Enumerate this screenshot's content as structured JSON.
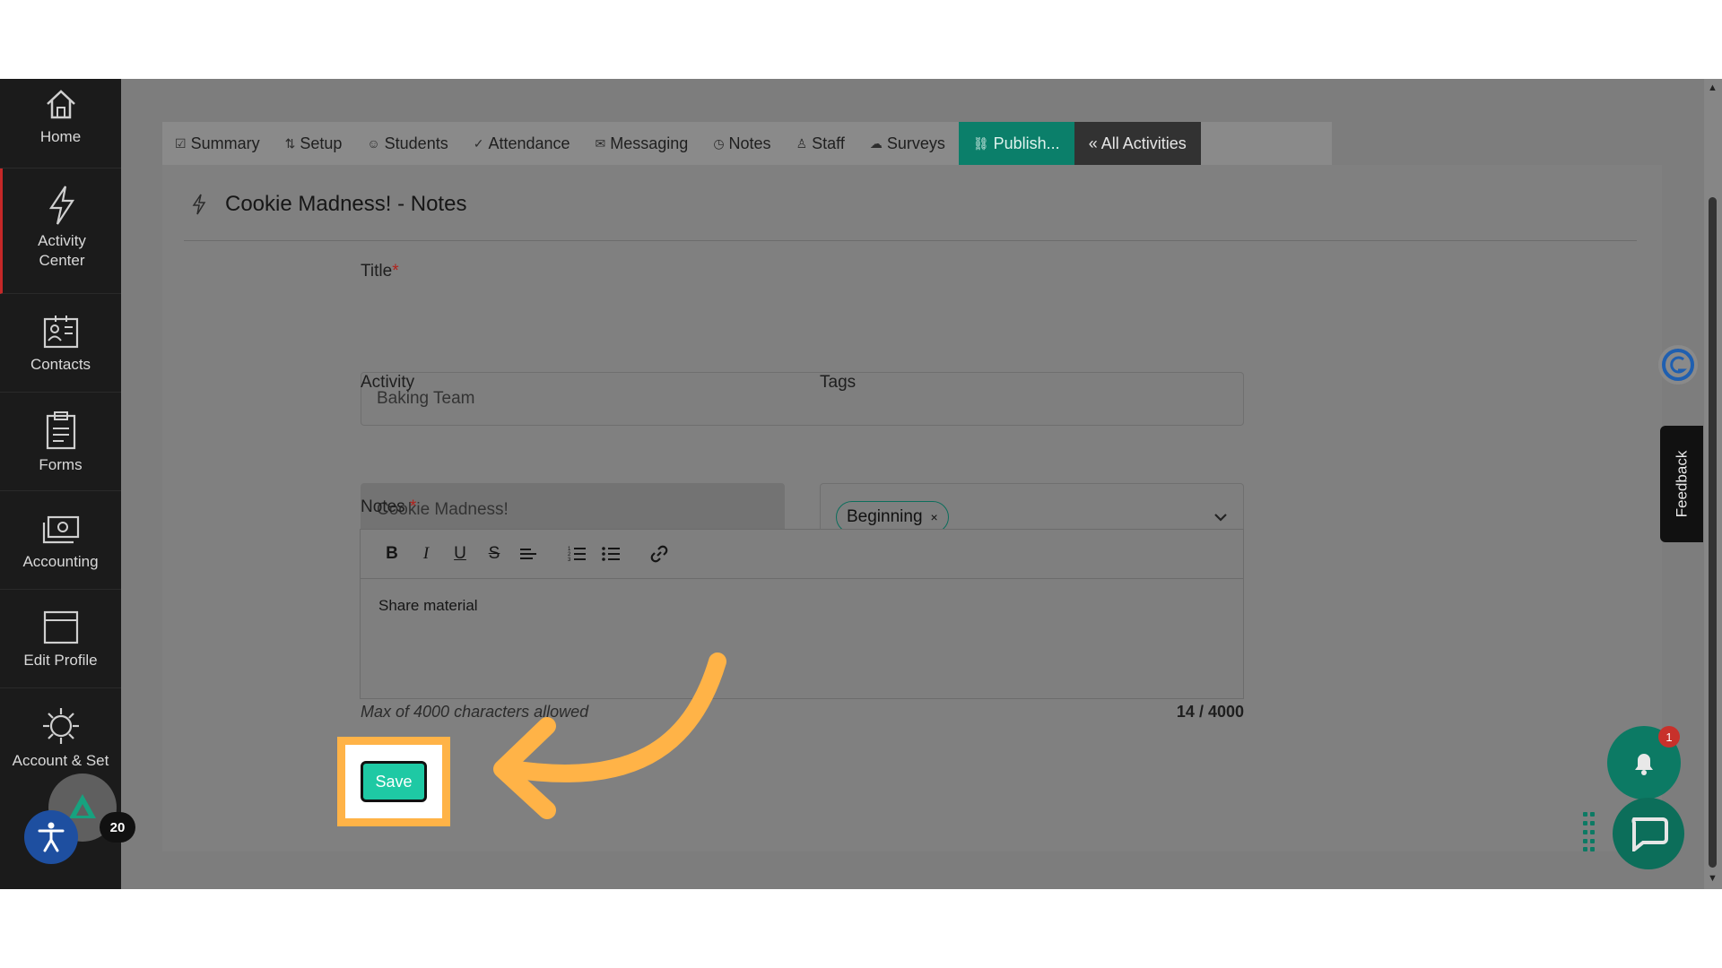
{
  "sidebar": {
    "items": [
      {
        "label": "Home",
        "icon": "home-icon"
      },
      {
        "label": "Activity Center",
        "icon": "bolt-icon"
      },
      {
        "label": "Contacts",
        "icon": "contacts-icon"
      },
      {
        "label": "Forms",
        "icon": "clipboard-icon"
      },
      {
        "label": "Accounting",
        "icon": "money-icon"
      },
      {
        "label": "Edit Profile",
        "icon": "profile-icon"
      },
      {
        "label": "Account & Set",
        "icon": "gear-icon"
      }
    ]
  },
  "tabs": [
    {
      "label": "Summary",
      "icon": "☑"
    },
    {
      "label": "Setup",
      "icon": "⇅"
    },
    {
      "label": "Students",
      "icon": "☺"
    },
    {
      "label": "Attendance",
      "icon": "✓"
    },
    {
      "label": "Messaging",
      "icon": "✉"
    },
    {
      "label": "Notes",
      "icon": "◷"
    },
    {
      "label": "Staff",
      "icon": "♙"
    },
    {
      "label": "Surveys",
      "icon": "☁"
    },
    {
      "label": "Publish...",
      "icon": "🔗"
    },
    {
      "label": "« All Activities",
      "icon": ""
    }
  ],
  "page": {
    "title": "Cookie Madness! - Notes"
  },
  "form": {
    "title_label": "Title",
    "title_value": "Baking Team",
    "activity_label": "Activity",
    "activity_value": "Cookie Madness!",
    "tags_label": "Tags",
    "tag_value": "Beginning",
    "tag_remove": "×",
    "notes_label": "Notes",
    "required_marker": "*",
    "notes_value": "Share material",
    "hint": "Max of 4000 characters allowed",
    "counter": "14 / 4000",
    "save_label": "Save"
  },
  "toolbar": {
    "bold": "B",
    "italic": "I",
    "underline": "U",
    "strike": "S"
  },
  "widgets": {
    "feedback_label": "Feedback",
    "notification_count": "1",
    "accessibility_count": "20"
  },
  "colors": {
    "accent": "#0b7f6a",
    "save_button": "#1ec9a4",
    "highlight": "#ffb347",
    "annotation_arrow": "#ffb347"
  }
}
